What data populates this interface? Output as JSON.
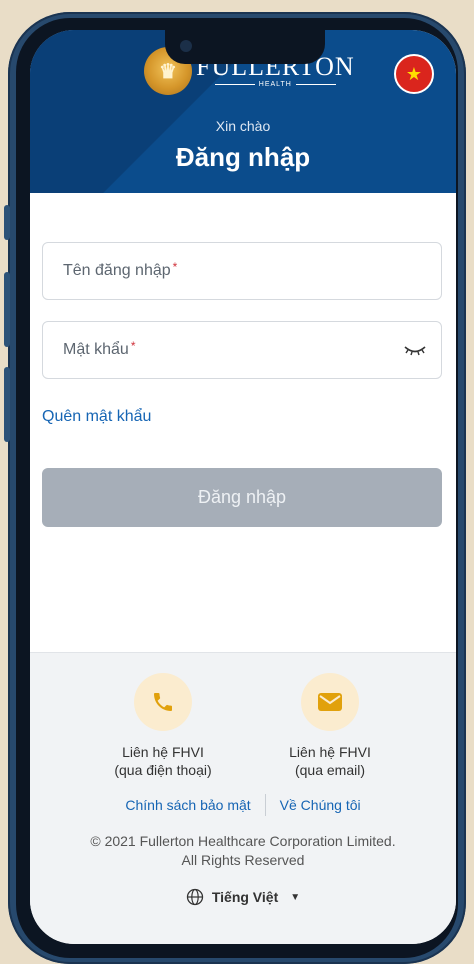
{
  "header": {
    "brand_name": "FULLERTON",
    "brand_sub": "HEALTH",
    "greeting": "Xin chào",
    "title": "Đăng nhập"
  },
  "form": {
    "username_label": "Tên đăng nhập",
    "password_label": "Mật khẩu",
    "required_mark": "*",
    "forgot_password": "Quên mật khẩu",
    "login_button": "Đăng nhập"
  },
  "footer": {
    "contact_phone_line1": "Liên hệ FHVI",
    "contact_phone_line2": "(qua điện thoại)",
    "contact_email_line1": "Liên hệ FHVI",
    "contact_email_line2": "(qua email)",
    "privacy_link": "Chính sách bảo mật",
    "about_link": "Về Chúng tôi",
    "copyright_line1": "© 2021 Fullerton Healthcare Corporation Limited.",
    "copyright_line2": "All Rights Reserved",
    "language": "Tiếng Việt"
  },
  "icons": {
    "logo": "lion-logo-icon",
    "flag": "vietnam-flag-icon",
    "eye": "eye-closed-icon",
    "phone": "phone-icon",
    "mail": "mail-icon",
    "globe": "globe-icon",
    "caret": "caret-down-icon"
  },
  "colors": {
    "header": "#0b4c8c",
    "link": "#1665b4",
    "button_disabled": "#a6aeb8",
    "required": "#d0313a",
    "icon_gold": "#e1a10c"
  }
}
